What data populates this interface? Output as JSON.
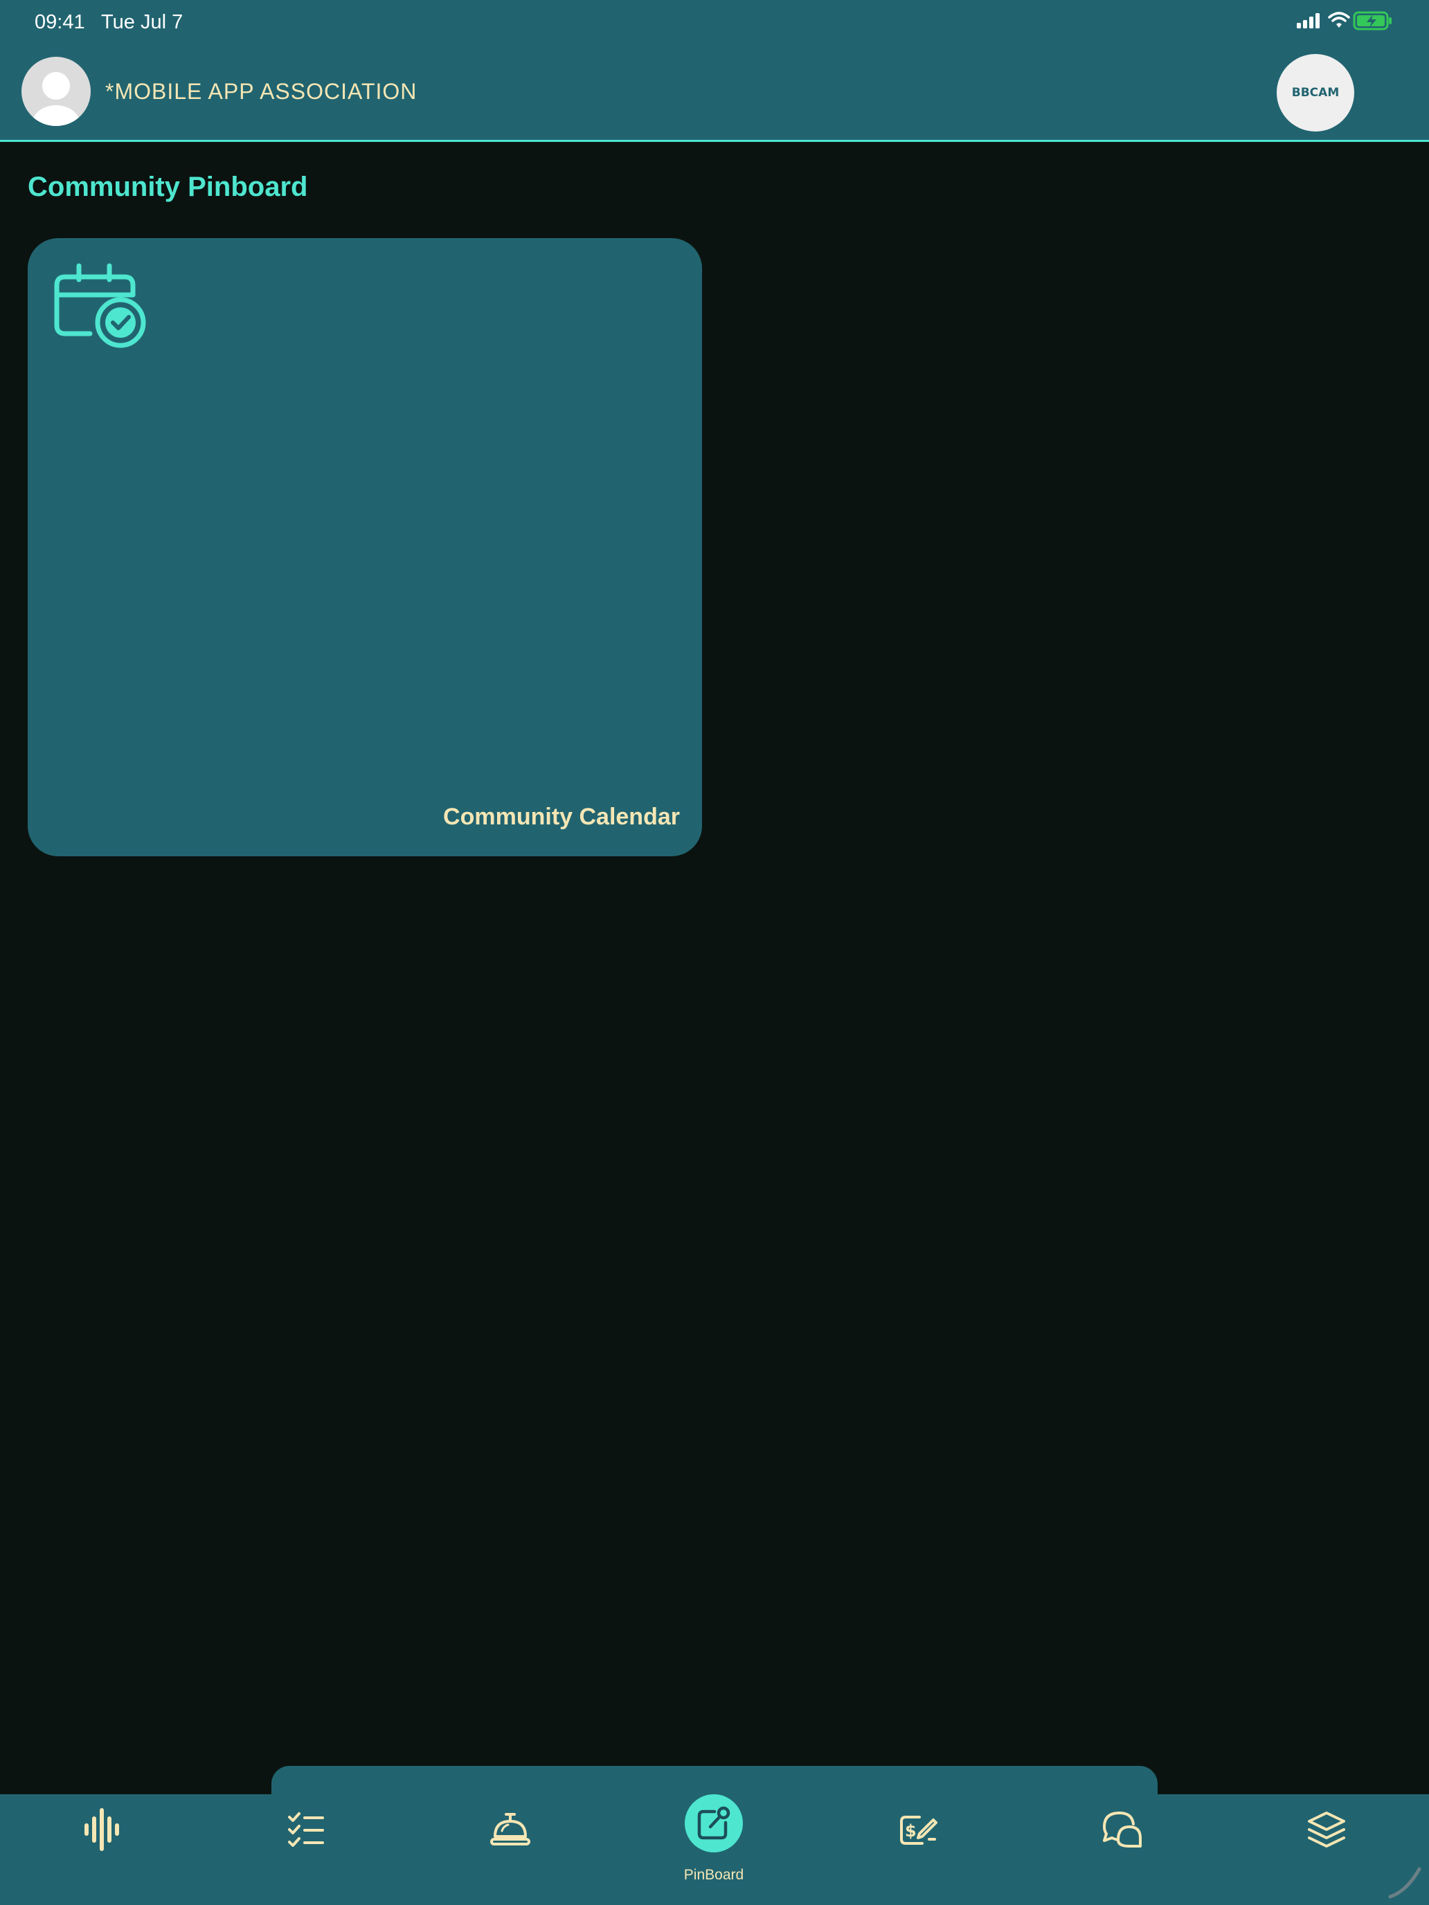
{
  "status_bar": {
    "time": "09:41",
    "date": "Tue Jul 7",
    "icons": [
      "signal-icon",
      "wifi-icon",
      "battery-charging-icon"
    ]
  },
  "header": {
    "avatar_icon": "person-avatar-icon",
    "association_name": "*MOBILE APP ASSOCIATION",
    "org_badge": "BBCAM"
  },
  "main": {
    "title": "Community Pinboard",
    "cards": [
      {
        "icon": "calendar-check-icon",
        "title": "Community Calendar"
      }
    ]
  },
  "tab_bar": {
    "tabs": [
      {
        "icon": "audio-wave-icon",
        "label": ""
      },
      {
        "icon": "checklist-icon",
        "label": ""
      },
      {
        "icon": "service-bell-icon",
        "label": ""
      },
      {
        "icon": "pinboard-icon",
        "label": "PinBoard",
        "active": true
      },
      {
        "icon": "dollar-edit-icon",
        "label": ""
      },
      {
        "icon": "chat-bubbles-icon",
        "label": ""
      },
      {
        "icon": "layers-icon",
        "label": ""
      }
    ]
  },
  "colors": {
    "header_bg": "#216470",
    "page_bg": "#0b1310",
    "accent": "#4ee6cf",
    "text_cream": "#f5e6b4"
  }
}
